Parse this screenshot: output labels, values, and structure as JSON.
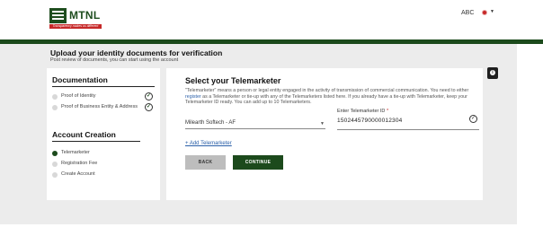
{
  "header": {
    "logo_text": "MTNL",
    "logo_tagline": "Transparency makes us different",
    "user_name": "ABC"
  },
  "page": {
    "title": "Upload your identity documents for verification",
    "subtitle": "Post review of documents, you can start using the account"
  },
  "sidebar": {
    "documentation_title": "Documentation",
    "documentation_items": [
      {
        "label": "Proof of Identity",
        "status": "verified"
      },
      {
        "label": "Proof of Business Entity & Address",
        "status": "verified"
      }
    ],
    "account_title": "Account Creation",
    "account_items": [
      {
        "label": "Telemarketer",
        "active": true
      },
      {
        "label": "Registration Fee",
        "active": false
      },
      {
        "label": "Create Account",
        "active": false
      }
    ]
  },
  "main": {
    "title": "Select your Telemarketer",
    "desc_1": "\"Telemarketer\" means a person or legal entity engaged in the activity of transmission of commercial communication. You need to either ",
    "desc_link": "register",
    "desc_2": " as a Telemarketer or tie-up with any of the Telemarketers listed here. If you already have a tie-up with Telemarketer, keep your Telemarketer ID ready. You can add up to 10 Telemarketers.",
    "telemarketer_select_value": "Milearth Softech - AF",
    "telemarketer_id_label": "Enter Telemarketer ID",
    "telemarketer_id_required": "*",
    "telemarketer_id_value": "1502445790000012304",
    "add_link": "+ Add Telemarketer",
    "back_label": "BACK",
    "continue_label": "CONTINUE"
  },
  "colors": {
    "brand_green": "#1c4a1c",
    "brand_red": "#c62828",
    "link_blue": "#2a5fa8",
    "page_bg": "#ececec"
  },
  "icons": {
    "info": "info-icon",
    "check": "check-circle-icon",
    "dropdown": "chevron-down-icon"
  }
}
